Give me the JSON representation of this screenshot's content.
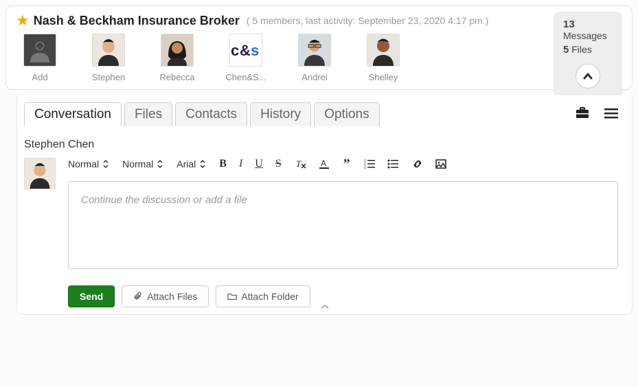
{
  "header": {
    "client_name": "Nash & Beckham Insurance Broker",
    "meta_prefix": "( ",
    "meta_text": "5 members, last activity: September 23, 2020 4:17 pm",
    "meta_suffix": " )"
  },
  "members": {
    "add_label": "Add",
    "items": [
      {
        "name": "Stephen",
        "bg": "#e7e0d9",
        "face": "#e0b089"
      },
      {
        "name": "Rebecca",
        "bg": "#d9cfc2",
        "face": "#c08a5a"
      },
      {
        "name": "Chen&S...",
        "bg": "#ffffff",
        "logo_text": "c&s",
        "logo_color_c": "#1f2348",
        "logo_color_amp": "#5bb75b",
        "logo_color_s": "#2a6dd6"
      },
      {
        "name": "Andrei",
        "bg": "#d6dce0",
        "face": "#d1a078"
      },
      {
        "name": "Shelley",
        "bg": "#e8e4de",
        "face": "#915c3e"
      }
    ]
  },
  "stats": {
    "messages_count": "13",
    "messages_label": " Messages",
    "files_count": "5",
    "files_label": " Files"
  },
  "tabs": {
    "items": [
      "Conversation",
      "Files",
      "Contacts",
      "History",
      "Options"
    ],
    "active_index": 0
  },
  "composer": {
    "author": "Stephen Chen",
    "placeholder": "Continue the discussion or add a file",
    "font_style": "Normal",
    "font_size": "Normal",
    "font_family": "Arial"
  },
  "actions": {
    "send": "Send",
    "attach_files": "Attach Files",
    "attach_folder": "Attach Folder"
  }
}
